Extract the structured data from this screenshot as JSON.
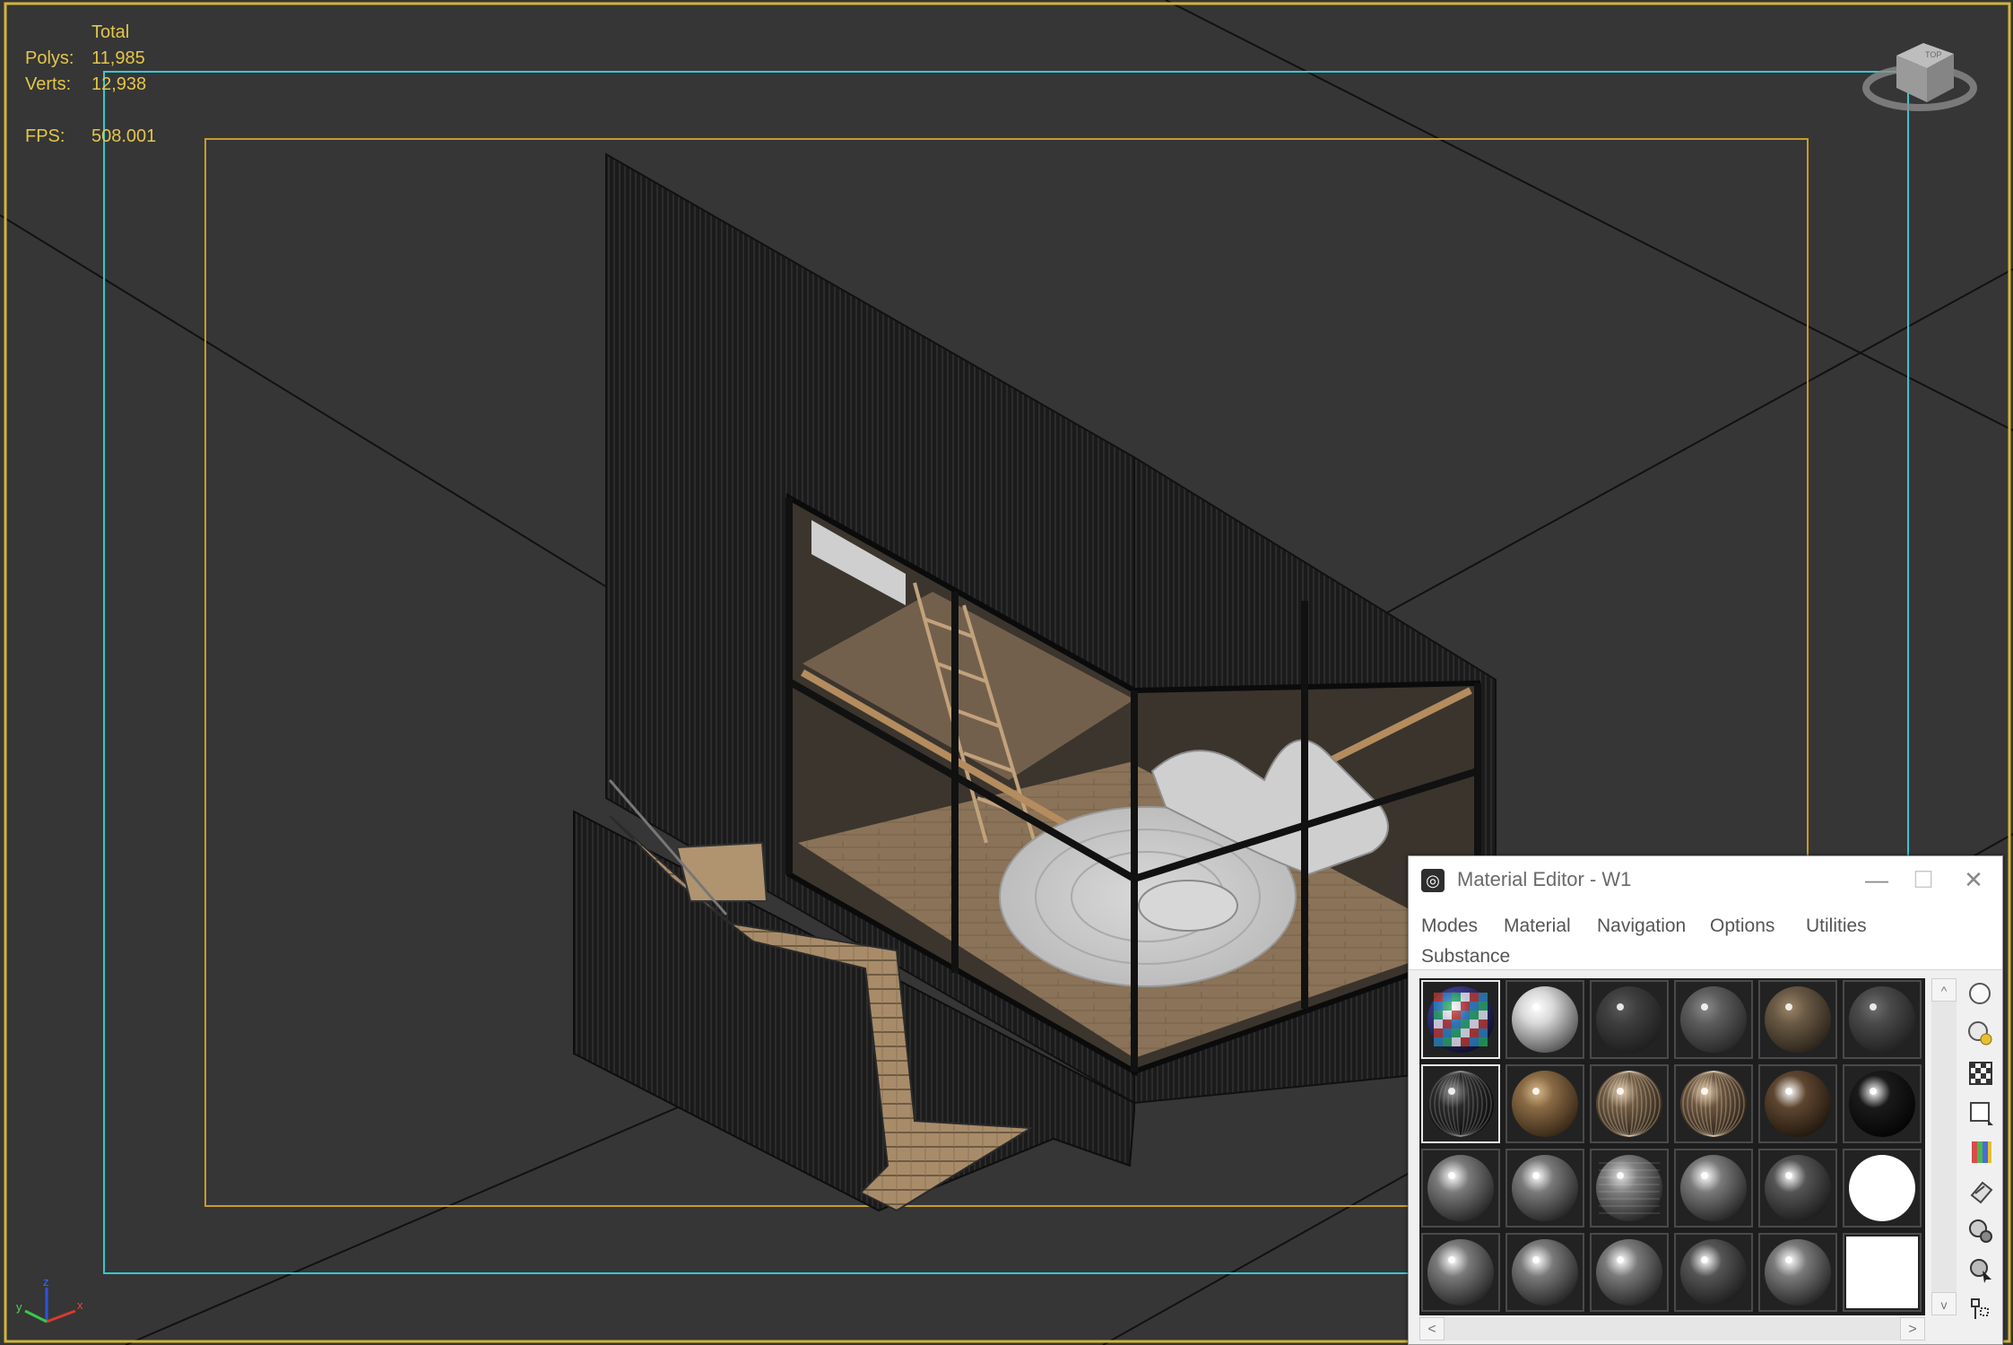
{
  "viewport": {
    "stats": {
      "header": "Total",
      "rows": [
        {
          "label": "Polys:",
          "value": "11,985"
        },
        {
          "label": "Verts:",
          "value": "12,938"
        }
      ],
      "fps_label": "FPS:",
      "fps_value": "508.001"
    },
    "colors": {
      "background": "#363636",
      "stats_text": "#e3c64a",
      "safe_frame_outer": "#d1b43c",
      "safe_frame_cyan": "#35c8cf",
      "safe_frame_inner": "#c99a2e"
    },
    "axis_gizmo": {
      "x": "x",
      "y": "y",
      "z": "z"
    }
  },
  "material_editor": {
    "title": "Material Editor - W1",
    "window_buttons": {
      "minimize": "—",
      "maximize": "☐",
      "close": "✕"
    },
    "menu": [
      "Modes",
      "Material",
      "Navigation",
      "Options",
      "Utilities",
      "Substance"
    ],
    "slots": [
      [
        {
          "type": "checker",
          "active": true
        },
        {
          "type": "white-glossy"
        },
        {
          "type": "dark-matte"
        },
        {
          "type": "gray-matte"
        },
        {
          "type": "brown-matte"
        },
        {
          "type": "dark-gray-matte"
        }
      ],
      [
        {
          "type": "dark-striped",
          "active": true
        },
        {
          "type": "wood-light"
        },
        {
          "type": "wood-grain"
        },
        {
          "type": "wood-striped"
        },
        {
          "type": "wood-glossy"
        },
        {
          "type": "black-glossy"
        }
      ],
      [
        {
          "type": "gray-glossy"
        },
        {
          "type": "gray-glossy"
        },
        {
          "type": "gray-lined"
        },
        {
          "type": "gray-glossy"
        },
        {
          "type": "dark-glossy"
        },
        {
          "type": "white-flat"
        }
      ],
      [
        {
          "type": "gray-glossy"
        },
        {
          "type": "gray-glossy"
        },
        {
          "type": "gray-glossy"
        },
        {
          "type": "dark-glossy"
        },
        {
          "type": "gray-glossy"
        },
        {
          "type": "white-square"
        }
      ]
    ],
    "scroll": {
      "up": "^",
      "down": "v",
      "left": "<",
      "right": ">"
    },
    "tools": [
      "sample-type-icon",
      "backlight-icon",
      "background-icon",
      "sample-uv-icon",
      "video-color-icon",
      "make-preview-icon",
      "options-icon",
      "select-by-material-icon",
      "material-map-navigator-icon"
    ]
  }
}
